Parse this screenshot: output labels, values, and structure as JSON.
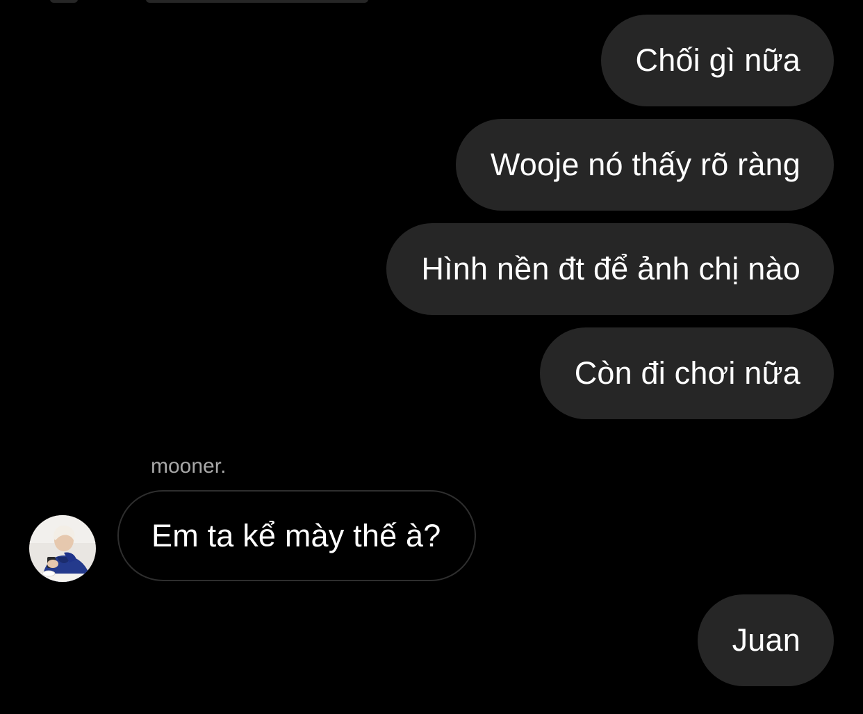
{
  "conversation": {
    "messages": [
      {
        "direction": "outgoing",
        "text": "Chối gì nữa"
      },
      {
        "direction": "outgoing",
        "text": "Wooje nó thấy rõ ràng"
      },
      {
        "direction": "outgoing",
        "text": "Hình nền đt để ảnh chị nào"
      },
      {
        "direction": "outgoing",
        "text": "Còn đi chơi nữa"
      },
      {
        "direction": "incoming",
        "sender": "mooner.",
        "text": "Em ta kể mày thế à?"
      },
      {
        "direction": "outgoing",
        "text": "Juan"
      }
    ]
  },
  "colors": {
    "background": "#000000",
    "outgoing_bubble": "#262626",
    "incoming_bubble_border": "#2e2e2e",
    "sender_name": "#a8a8a8",
    "text": "#ffffff"
  },
  "icons": {
    "avatar": "user-avatar-photo"
  }
}
